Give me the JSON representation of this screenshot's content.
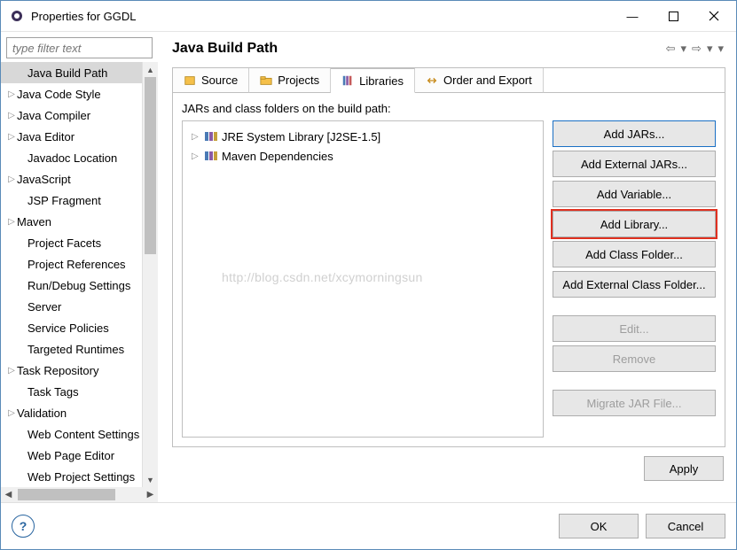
{
  "window": {
    "title": "Properties for GGDL"
  },
  "filter": {
    "placeholder": "type filter text"
  },
  "sidebar": [
    {
      "label": "Java Build Path",
      "exp": false,
      "indent": true,
      "sel": true
    },
    {
      "label": "Java Code Style",
      "exp": true,
      "indent": false
    },
    {
      "label": "Java Compiler",
      "exp": true,
      "indent": false
    },
    {
      "label": "Java Editor",
      "exp": true,
      "indent": false
    },
    {
      "label": "Javadoc Location",
      "exp": false,
      "indent": true
    },
    {
      "label": "JavaScript",
      "exp": true,
      "indent": false
    },
    {
      "label": "JSP Fragment",
      "exp": false,
      "indent": true
    },
    {
      "label": "Maven",
      "exp": true,
      "indent": false
    },
    {
      "label": "Project Facets",
      "exp": false,
      "indent": true
    },
    {
      "label": "Project References",
      "exp": false,
      "indent": true
    },
    {
      "label": "Run/Debug Settings",
      "exp": false,
      "indent": true
    },
    {
      "label": "Server",
      "exp": false,
      "indent": true
    },
    {
      "label": "Service Policies",
      "exp": false,
      "indent": true
    },
    {
      "label": "Targeted Runtimes",
      "exp": false,
      "indent": true
    },
    {
      "label": "Task Repository",
      "exp": true,
      "indent": false
    },
    {
      "label": "Task Tags",
      "exp": false,
      "indent": true
    },
    {
      "label": "Validation",
      "exp": true,
      "indent": false
    },
    {
      "label": "Web Content Settings",
      "exp": false,
      "indent": true
    },
    {
      "label": "Web Page Editor",
      "exp": false,
      "indent": true
    },
    {
      "label": "Web Project Settings",
      "exp": false,
      "indent": true,
      "last": true
    }
  ],
  "main": {
    "title": "Java Build Path",
    "tabs": [
      {
        "label": "Source",
        "icon": "source"
      },
      {
        "label": "Projects",
        "icon": "projects"
      },
      {
        "label": "Libraries",
        "icon": "libraries",
        "active": true
      },
      {
        "label": "Order and Export",
        "icon": "order"
      }
    ],
    "desc": "JARs and class folders on the build path:",
    "libs": [
      {
        "label": "JRE System Library [J2SE-1.5]"
      },
      {
        "label": "Maven Dependencies"
      }
    ],
    "watermark": "http://blog.csdn.net/xcymorningsun",
    "buttons": [
      {
        "label": "Add JARs...",
        "state": "sel-blue"
      },
      {
        "label": "Add External JARs..."
      },
      {
        "label": "Add Variable..."
      },
      {
        "label": "Add Library...",
        "state": "sel-red"
      },
      {
        "label": "Add Class Folder..."
      },
      {
        "label": "Add External Class Folder..."
      },
      {
        "gap": true
      },
      {
        "label": "Edit...",
        "disabled": true
      },
      {
        "label": "Remove",
        "disabled": true
      },
      {
        "gap": true
      },
      {
        "label": "Migrate JAR File...",
        "disabled": true
      }
    ],
    "apply": "Apply"
  },
  "footer": {
    "ok": "OK",
    "cancel": "Cancel"
  }
}
